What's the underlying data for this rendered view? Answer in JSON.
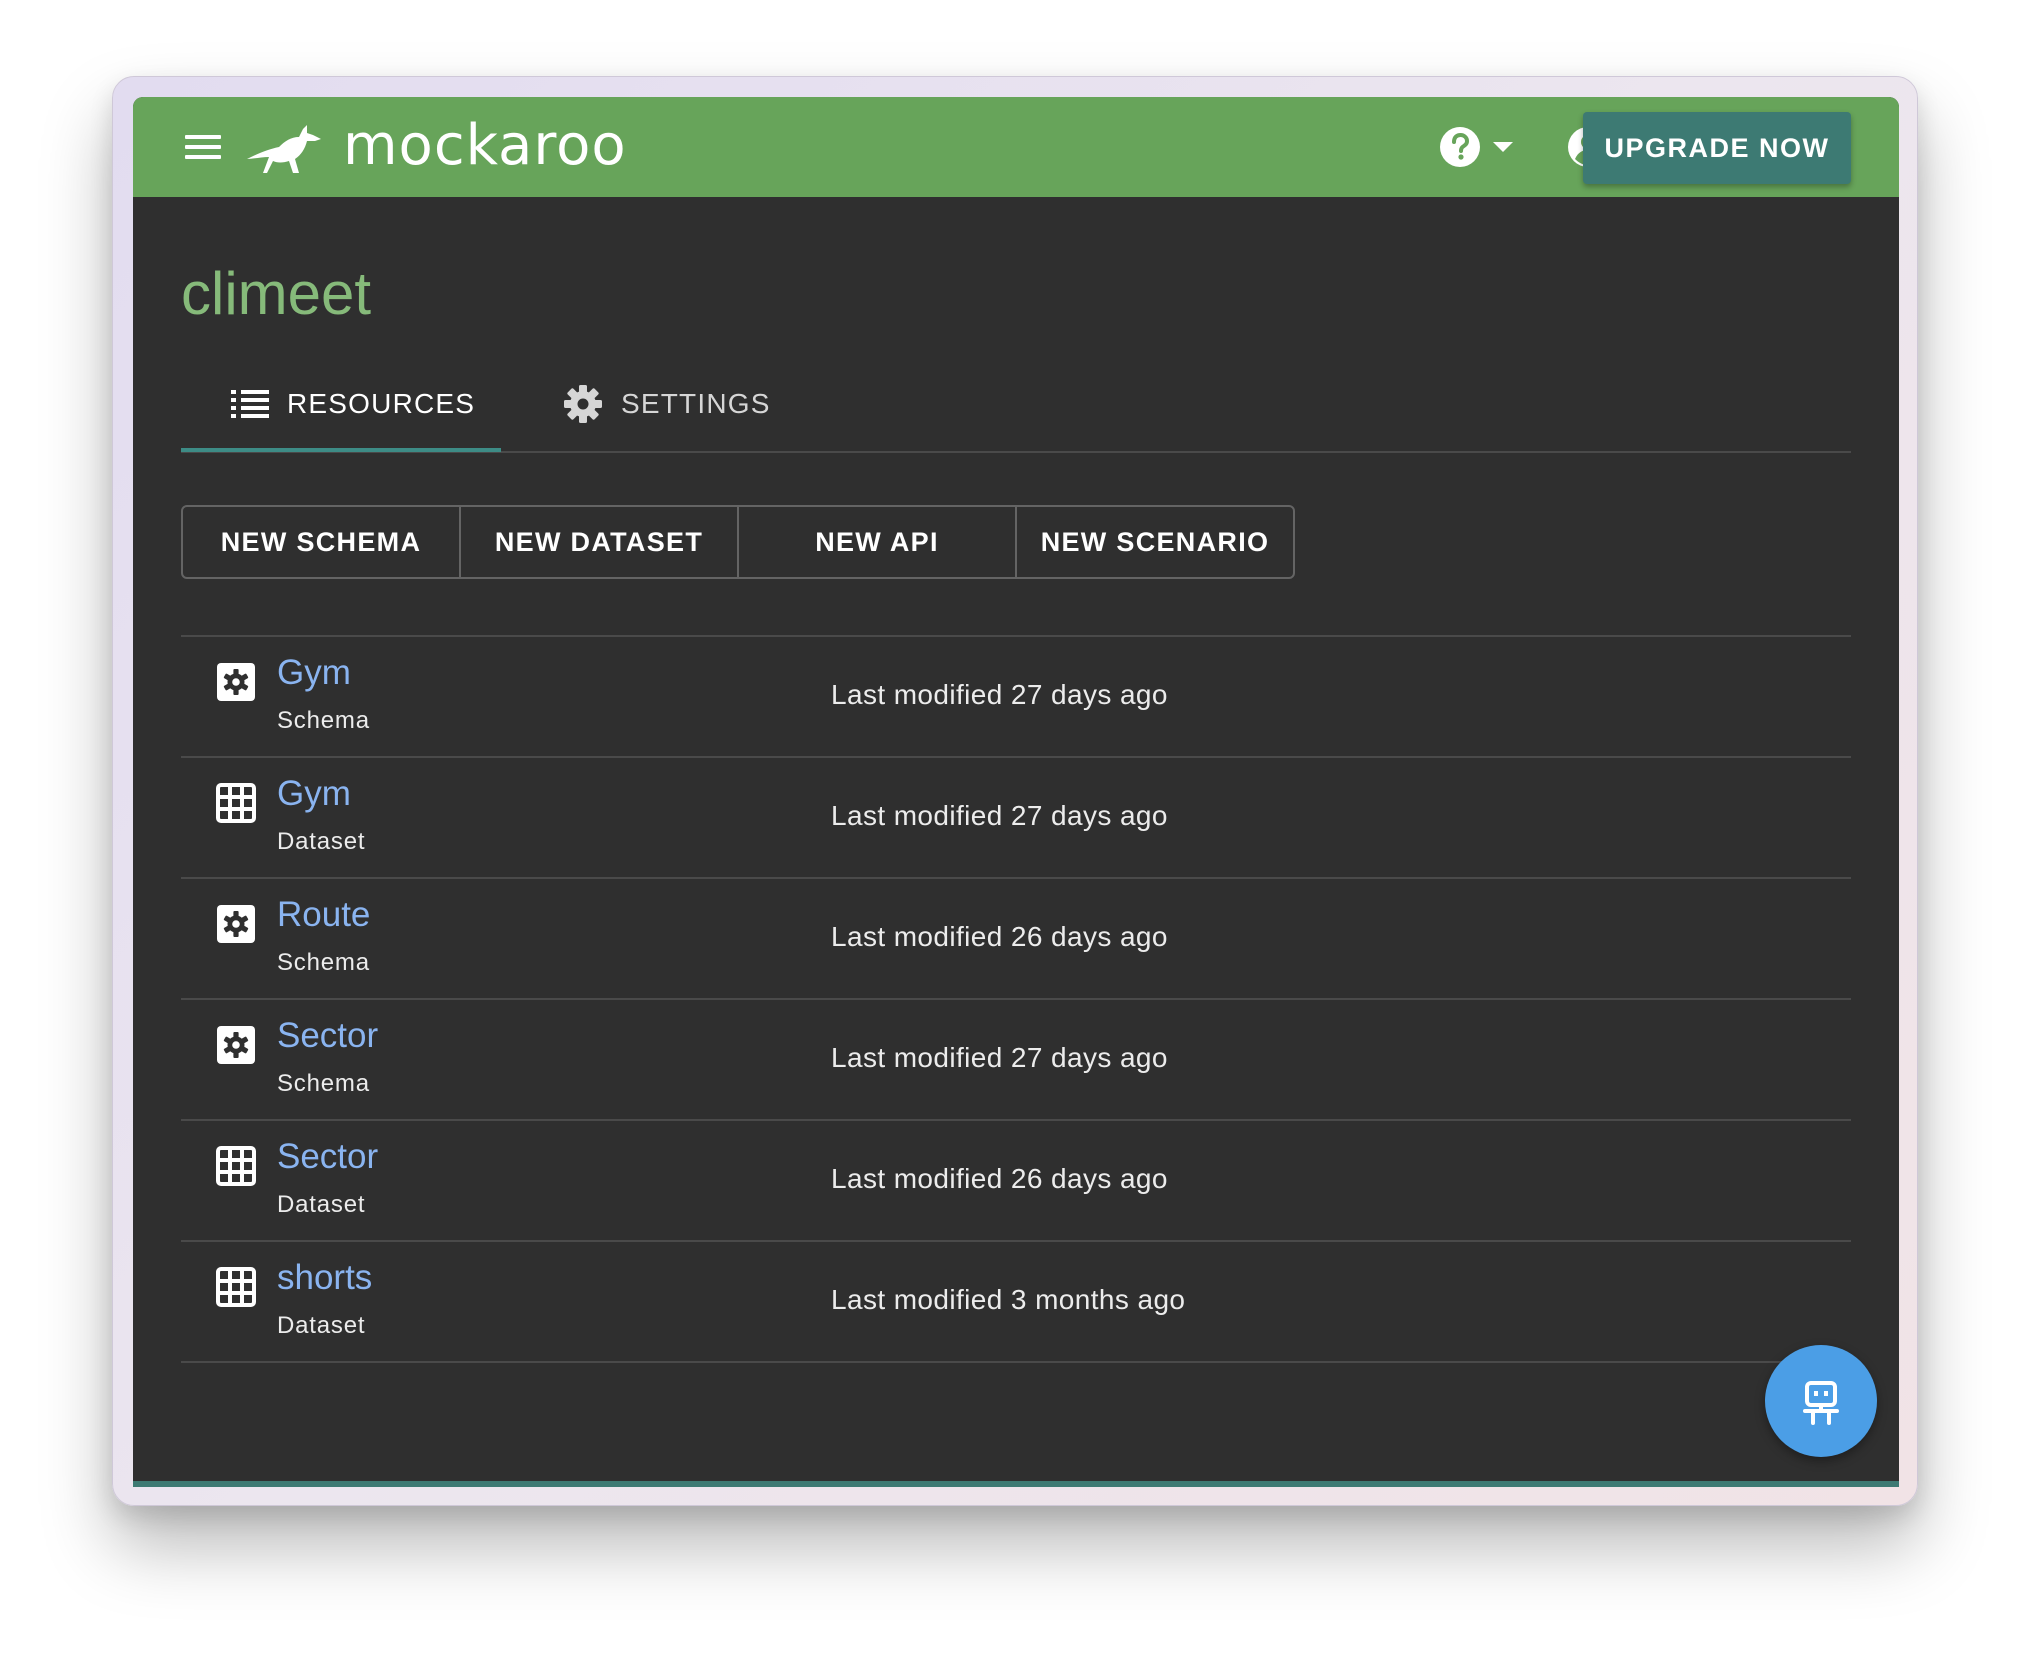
{
  "header": {
    "logo_text": "mockaroo",
    "upgrade_label": "UPGRADE NOW",
    "icons": [
      "menu-icon",
      "kangaroo-logo",
      "help-icon",
      "account-icon"
    ],
    "brand_color": "#67a45a",
    "accent_color": "#3d7a73"
  },
  "page": {
    "title": "climeet"
  },
  "tabs": [
    {
      "label": "RESOURCES",
      "icon": "list-icon",
      "active": true
    },
    {
      "label": "SETTINGS",
      "icon": "gear-icon",
      "active": false
    }
  ],
  "actions": [
    {
      "label": "NEW SCHEMA"
    },
    {
      "label": "NEW DATASET"
    },
    {
      "label": "NEW API"
    },
    {
      "label": "NEW SCENARIO"
    }
  ],
  "resources": [
    {
      "name": "Gym",
      "type": "Schema",
      "modified": "Last modified 27 days ago",
      "icon": "schema-gear-icon"
    },
    {
      "name": "Gym",
      "type": "Dataset",
      "modified": "Last modified 27 days ago",
      "icon": "dataset-grid-icon"
    },
    {
      "name": "Route",
      "type": "Schema",
      "modified": "Last modified 26 days ago",
      "icon": "schema-gear-icon"
    },
    {
      "name": "Sector",
      "type": "Schema",
      "modified": "Last modified 27 days ago",
      "icon": "schema-gear-icon"
    },
    {
      "name": "Sector",
      "type": "Dataset",
      "modified": "Last modified 26 days ago",
      "icon": "dataset-grid-icon"
    },
    {
      "name": "shorts",
      "type": "Dataset",
      "modified": "Last modified 3 months ago",
      "icon": "dataset-grid-icon"
    }
  ],
  "fab": {
    "icon": "robot-icon",
    "color": "#4b9ee6"
  }
}
